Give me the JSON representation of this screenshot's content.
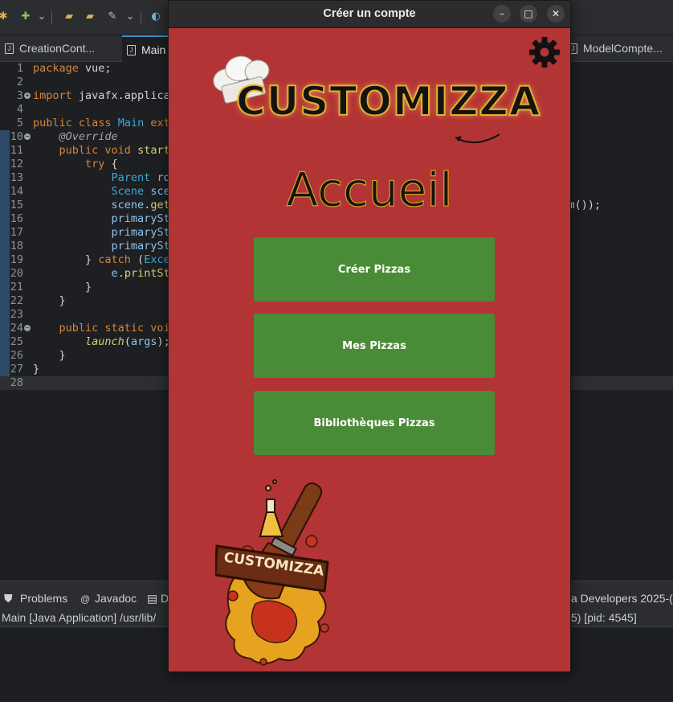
{
  "window": {
    "title": "Créer un compte",
    "minimize_glyph": "–",
    "maximize_glyph": "□",
    "close_glyph": "✕"
  },
  "app": {
    "logo_text": "CUSTOMIZZA",
    "heading": "Accueil",
    "buttons": [
      {
        "label": "Créer Pizzas"
      },
      {
        "label": "Mes Pizzas"
      },
      {
        "label": "Bibliothèques Pizzas"
      }
    ],
    "badge_text": "CUSTOMIZZA",
    "settings_icon": "gear-icon"
  },
  "ide": {
    "tabs": [
      {
        "label": "CreationCont..."
      },
      {
        "label": "Main"
      },
      {
        "label": "ModelCompte..."
      }
    ],
    "bottom_tabs": {
      "problems": "Problems",
      "javadoc": "Javadoc",
      "declaration": "D",
      "right_text": "a Developers 2025-("
    },
    "console_left": "Main [Java Application] /usr/lib/",
    "console_right": "5) [pid: 4545]"
  },
  "colors": {
    "window_bg": "#b33434",
    "button_bg": "#4a8b38",
    "title_bar": "#2c2c2c",
    "ide_bg": "#1e1f22"
  }
}
